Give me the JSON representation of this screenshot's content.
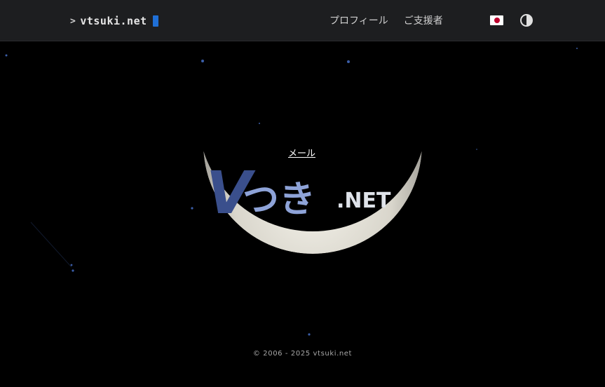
{
  "header": {
    "brand_prompt": ">",
    "brand_name": "vtsuki.net",
    "nav": [
      {
        "label": "プロフィール"
      },
      {
        "label": "ご支援者"
      }
    ],
    "language_icon": "japan-flag-icon",
    "theme_icon": "contrast-icon"
  },
  "hero": {
    "mail_label": "メール",
    "logo": {
      "v": "V",
      "kana": "つき",
      "suffix": ".NET"
    }
  },
  "footer": {
    "copyright": "© 2006 - 2025 vtsuki.net"
  },
  "colors": {
    "header_bg": "#1d1e20",
    "accent_cursor": "#1f6fd6",
    "flag_red": "#bc002d",
    "logo_v": "#3a4f8c",
    "logo_kana": "#8ea3d8"
  }
}
